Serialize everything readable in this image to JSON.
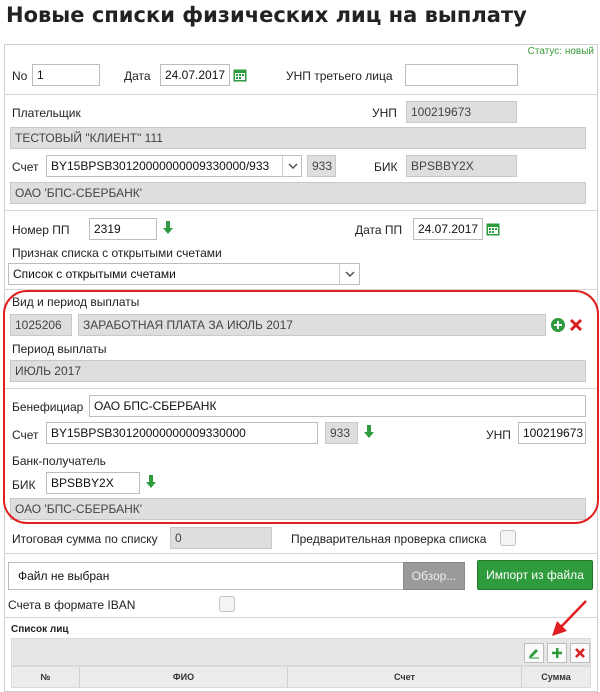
{
  "page_title": "Новые списки физических лиц на выплату",
  "status": "Статус:  новый",
  "header": {
    "no_label": "No",
    "no_value": "1",
    "date_label": "Дата",
    "date_value": "24.07.2017",
    "third_party_unp_label": "УНП третьего лица",
    "third_party_unp_value": ""
  },
  "payer": {
    "label": "Плательщик",
    "unp_label": "УНП",
    "unp_value": "100219673",
    "name": "ТЕСТОВЫЙ \"КЛИЕНТ\" 111",
    "account_label": "Счет",
    "account_value": "BY15BPSB30120000000009330000/933",
    "currency": "933",
    "bic_label": "БИК",
    "bic_value": "BPSBBY2X",
    "bank_name": "ОАО 'БПС-СБЕРБАНК'"
  },
  "payment": {
    "pp_number_label": "Номер ПП",
    "pp_number_value": "2319",
    "pp_date_label": "Дата ПП",
    "pp_date_value": "24.07.2017",
    "list_flag_label": "Признак списка с открытыми счетами",
    "list_flag_value": "Список с открытыми счетами"
  },
  "payout": {
    "type_label": "Вид и период выплаты",
    "type_code": "1025206",
    "type_name": "ЗАРАБОТНАЯ ПЛАТА ЗА ИЮЛЬ 2017",
    "period_label": "Период выплаты",
    "period_value": "ИЮЛЬ 2017"
  },
  "beneficiary": {
    "label": "Бенефициар",
    "value": "ОАО БПС-СБЕРБАНК",
    "account_label": "Счет",
    "account_value": "BY15BPSB30120000000009330000",
    "currency": "933",
    "unp_label": "УНП",
    "unp_value": "100219673",
    "bank_label": "Банк-получатель",
    "bic_label": "БИК",
    "bic_value": "BPSBBY2X",
    "bank_name": "ОАО 'БПС-СБЕРБАНК'"
  },
  "totals": {
    "total_label": "Итоговая сумма по списку",
    "total_value": "0",
    "precheck_label": "Предварительная проверка списка"
  },
  "file": {
    "placeholder": "Файл не выбран",
    "browse_label": "Обзор...",
    "import_label": "Импорт из файла",
    "iban_label": "Счета в формате IBAN"
  },
  "persons": {
    "title": "Список лиц",
    "columns": [
      "№",
      "ФИО",
      "Счет",
      "Сумма"
    ]
  },
  "colors": {
    "accent_green": "#2e9b3c",
    "annotation_red": "#e02020",
    "readonly_gray": "#dedede"
  }
}
